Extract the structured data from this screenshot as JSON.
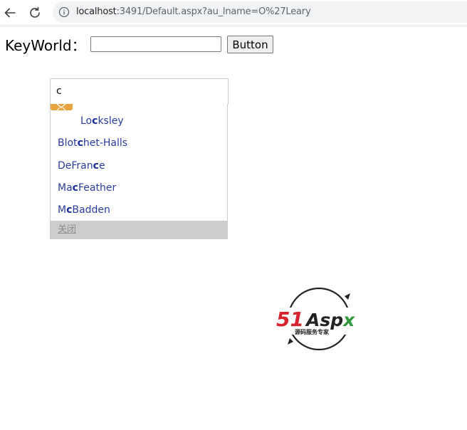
{
  "browser": {
    "url_host": "localhost",
    "url_rest": ":3491/Default.aspx?au_lname=O%27Leary",
    "icons": [
      "back-arrow-icon",
      "reload-icon",
      "info-icon"
    ]
  },
  "form": {
    "label": "KeyWorld：",
    "input_value": "",
    "button_label": "Button"
  },
  "autocomplete": {
    "query": "c",
    "items": [
      {
        "pre": "Lo",
        "match": "c",
        "post": "ksley"
      },
      {
        "pre": "Blot",
        "match": "c",
        "post": "het-Halls"
      },
      {
        "pre": "DeFran",
        "match": "c",
        "post": "e"
      },
      {
        "pre": "Ma",
        "match": "c",
        "post": "Feather"
      },
      {
        "pre": "M",
        "match": "c",
        "post": "Badden"
      }
    ],
    "close_label": "关闭"
  },
  "logo": {
    "brand_51": "51",
    "brand_aspx": "Aspx",
    "tagline": "源码服务专家",
    "colors": {
      "red": "#d9232d",
      "green": "#2e9a3a",
      "dark": "#222222"
    }
  }
}
